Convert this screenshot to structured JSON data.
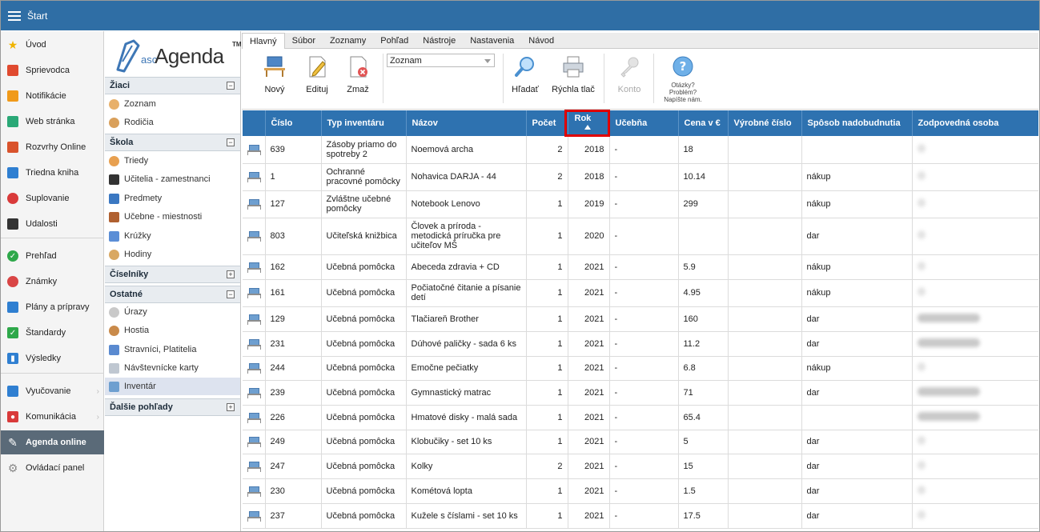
{
  "topbar": {
    "title": "Štart"
  },
  "leftnav": {
    "items": [
      {
        "label": "Úvod",
        "icon": "star-icon",
        "color": "#f0b400"
      },
      {
        "label": "Sprievodca",
        "icon": "wand-icon",
        "color": "#e04a2f"
      },
      {
        "label": "Notifikácie",
        "icon": "envelope-icon",
        "color": "#f09a1a"
      },
      {
        "label": "Web stránka",
        "icon": "house-icon",
        "color": "#2aa876"
      },
      {
        "label": "Rozvrhy Online",
        "icon": "timetable-icon",
        "color": "#d9532c"
      },
      {
        "label": "Triedna kniha",
        "icon": "book-icon",
        "color": "#2f7fd1"
      },
      {
        "label": "Suplovanie",
        "icon": "substitute-icon",
        "color": "#d93a3a"
      },
      {
        "label": "Udalosti",
        "icon": "calendar-icon",
        "color": "#333333"
      },
      {
        "label": "Prehľad",
        "icon": "check-circle-icon",
        "color": "#2ea84a"
      },
      {
        "label": "Známky",
        "icon": "grades-icon",
        "color": "#d94545"
      },
      {
        "label": "Plány a prípravy",
        "icon": "briefcase-icon",
        "color": "#2f7fd1"
      },
      {
        "label": "Štandardy",
        "icon": "shield-check-icon",
        "color": "#2ea84a"
      },
      {
        "label": "Výsledky",
        "icon": "bar-chart-icon",
        "color": "#2f7fd1"
      },
      {
        "label": "Vyučovanie",
        "icon": "open-book-icon",
        "color": "#2f7fd1"
      },
      {
        "label": "Komunikácia",
        "icon": "chat-icon",
        "color": "#d93a3a"
      },
      {
        "label": "Agenda online",
        "icon": "agenda-pen-icon",
        "color": "#ffffff"
      },
      {
        "label": "Ovládací panel",
        "icon": "gear-icon",
        "color": "#888888"
      }
    ]
  },
  "logo": {
    "asc": "asc",
    "brand": "Agenda",
    "tm": "TM"
  },
  "tree": {
    "zaci": {
      "title": "Žiaci",
      "toggle": "−",
      "items": [
        "Zoznam",
        "Rodičia"
      ]
    },
    "skola": {
      "title": "Škola",
      "toggle": "−",
      "items": [
        "Triedy",
        "Učitelia - zamestnanci",
        "Predmety",
        "Učebne - miestnosti",
        "Krúžky",
        "Hodiny"
      ]
    },
    "ciselniky": {
      "title": "Číselníky",
      "toggle": "+"
    },
    "ostatne": {
      "title": "Ostatné",
      "toggle": "−",
      "items": [
        "Úrazy",
        "Hostia",
        "Stravníci, Platitelia",
        "Návštevnícke karty",
        "Inventár"
      ]
    },
    "dalsie": {
      "title": "Ďalšie pohľady",
      "toggle": "+"
    }
  },
  "ribbon": {
    "tabs": [
      "Hlavný",
      "Súbor",
      "Zoznamy",
      "Pohľad",
      "Nástroje",
      "Nastavenia",
      "Návod"
    ],
    "buttons": {
      "new": "Nový",
      "edit": "Edituj",
      "delete": "Zmaž",
      "search": "Hľadať",
      "quick_print": "Rýchla tlač",
      "contact": "Konto"
    },
    "view_select": "Zoznam",
    "help": {
      "line1": "Otázky?",
      "line2": "Problém?",
      "line3": "Napíšte nám."
    }
  },
  "grid": {
    "columns": [
      "Číslo",
      "Typ inventáru",
      "Názov",
      "Počet",
      "Rok",
      "Učebňa",
      "Cena v €",
      "Výrobné číslo",
      "Spôsob nadobudnutia",
      "Zodpovedná osoba"
    ],
    "rows": [
      {
        "cislo": "639",
        "typ": "Zásoby priamo do spotreby 2",
        "nazov": "Noemová archa",
        "pocet": "2",
        "rok": "2018",
        "ucebna": "-",
        "cena": "18",
        "vyrobne": "",
        "sposob": "",
        "osoba": "faint"
      },
      {
        "cislo": "1",
        "typ": "Ochranné pracovné pomôcky",
        "nazov": "Nohavica DARJA - 44",
        "pocet": "2",
        "rok": "2018",
        "ucebna": "-",
        "cena": "10.14",
        "vyrobne": "",
        "sposob": "nákup",
        "osoba": "faint"
      },
      {
        "cislo": "127",
        "typ": "Zvláštne učebné pomôcky",
        "nazov": "Notebook Lenovo",
        "pocet": "1",
        "rok": "2019",
        "ucebna": "-",
        "cena": "299",
        "vyrobne": "",
        "sposob": "nákup",
        "osoba": "faint"
      },
      {
        "cislo": "803",
        "typ": "Učiteľská knižbica",
        "nazov": "Človek a príroda - metodická príručka pre učiteľov MŠ",
        "pocet": "1",
        "rok": "2020",
        "ucebna": "-",
        "cena": "",
        "vyrobne": "",
        "sposob": "dar",
        "osoba": "faint"
      },
      {
        "cislo": "162",
        "typ": "Učebná pomôcka",
        "nazov": "Abeceda zdravia + CD",
        "pocet": "1",
        "rok": "2021",
        "ucebna": "-",
        "cena": "5.9",
        "vyrobne": "",
        "sposob": "nákup",
        "osoba": "faint"
      },
      {
        "cislo": "161",
        "typ": "Učebná pomôcka",
        "nazov": "Počiatočné čitanie a písanie detí",
        "pocet": "1",
        "rok": "2021",
        "ucebna": "-",
        "cena": "4.95",
        "vyrobne": "",
        "sposob": "nákup",
        "osoba": "faint"
      },
      {
        "cislo": "129",
        "typ": "Učebná pomôcka",
        "nazov": "Tlačiareň Brother",
        "pocet": "1",
        "rok": "2021",
        "ucebna": "-",
        "cena": "160",
        "vyrobne": "",
        "sposob": "dar",
        "osoba": "blur"
      },
      {
        "cislo": "231",
        "typ": "Učebná pomôcka",
        "nazov": "Dúhové paličky - sada 6 ks",
        "pocet": "1",
        "rok": "2021",
        "ucebna": "-",
        "cena": "11.2",
        "vyrobne": "",
        "sposob": "dar",
        "osoba": "blur"
      },
      {
        "cislo": "244",
        "typ": "Učebná pomôcka",
        "nazov": "Emočne pečiatky",
        "pocet": "1",
        "rok": "2021",
        "ucebna": "-",
        "cena": "6.8",
        "vyrobne": "",
        "sposob": "nákup",
        "osoba": "faint"
      },
      {
        "cislo": "239",
        "typ": "Učebná pomôcka",
        "nazov": "Gymnastický matrac",
        "pocet": "1",
        "rok": "2021",
        "ucebna": "-",
        "cena": "71",
        "vyrobne": "",
        "sposob": "dar",
        "osoba": "blur"
      },
      {
        "cislo": "226",
        "typ": "Učebná pomôcka",
        "nazov": "Hmatové disky - malá sada",
        "pocet": "1",
        "rok": "2021",
        "ucebna": "-",
        "cena": "65.4",
        "vyrobne": "",
        "sposob": "",
        "osoba": "blur"
      },
      {
        "cislo": "249",
        "typ": "Učebná pomôcka",
        "nazov": "Klobučiky - set 10 ks",
        "pocet": "1",
        "rok": "2021",
        "ucebna": "-",
        "cena": "5",
        "vyrobne": "",
        "sposob": "dar",
        "osoba": "faint"
      },
      {
        "cislo": "247",
        "typ": "Učebná pomôcka",
        "nazov": "Kolky",
        "pocet": "2",
        "rok": "2021",
        "ucebna": "-",
        "cena": "15",
        "vyrobne": "",
        "sposob": "dar",
        "osoba": "faint"
      },
      {
        "cislo": "230",
        "typ": "Učebná pomôcka",
        "nazov": "Kométová lopta",
        "pocet": "1",
        "rok": "2021",
        "ucebna": "-",
        "cena": "1.5",
        "vyrobne": "",
        "sposob": "dar",
        "osoba": "faint"
      },
      {
        "cislo": "237",
        "typ": "Učebná pomôcka",
        "nazov": "Kužele s číslami - set 10 ks",
        "pocet": "1",
        "rok": "2021",
        "ucebna": "-",
        "cena": "17.5",
        "vyrobne": "",
        "sposob": "dar",
        "osoba": "faint"
      }
    ]
  },
  "colors": {
    "header_blue": "#2e72b0",
    "topbar_blue": "#2f6ea5",
    "highlight_red": "#e00000",
    "active_nav": "#5a6a78"
  }
}
